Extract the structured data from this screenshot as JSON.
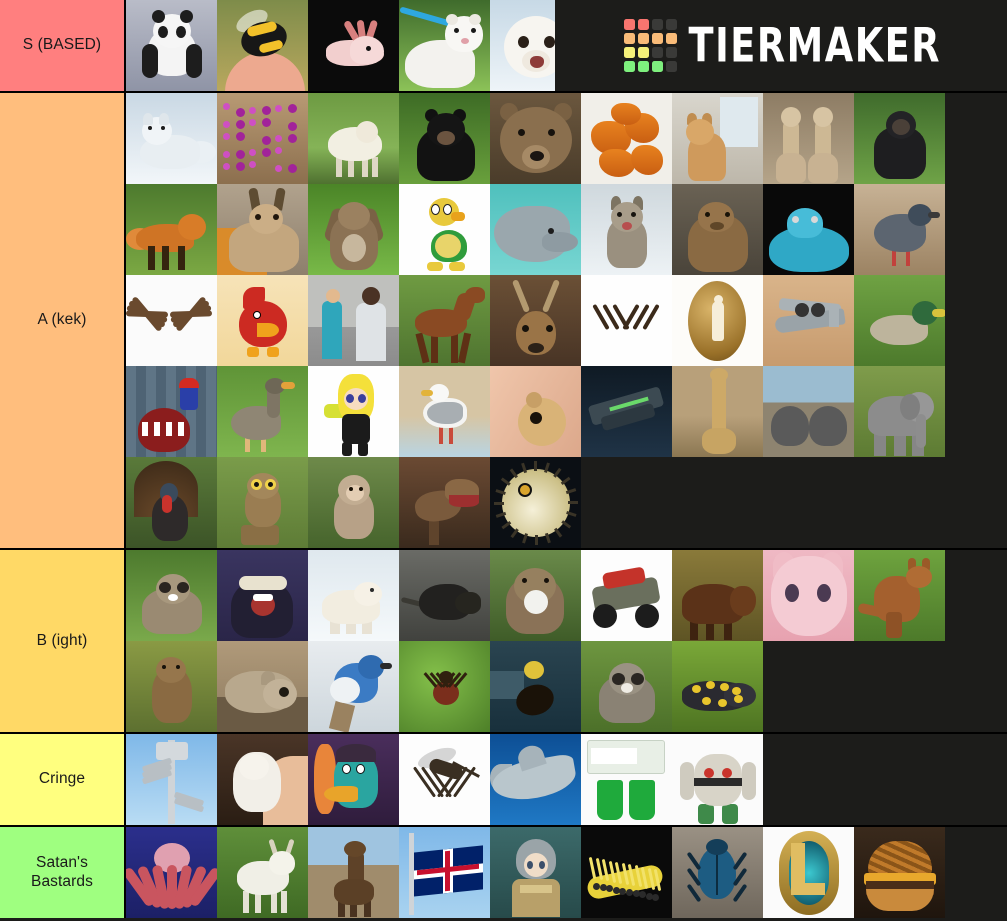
{
  "brand": {
    "name": "TIERMAKER",
    "logo_grid_colors": [
      [
        "#f9756f",
        "#f9756f",
        "#3a3a38",
        "#3a3a38"
      ],
      [
        "#f9bb78",
        "#f9bb78",
        "#f9bb78",
        "#f9bb78"
      ],
      [
        "#f5f07a",
        "#f5f07a",
        "#3a3a38",
        "#3a3a38"
      ],
      [
        "#7ef07e",
        "#7ef07e",
        "#7ef07e",
        "#3a3a38"
      ]
    ],
    "text_color": "#ffffff",
    "background": "#1c1c1a"
  },
  "tiers": [
    {
      "label": "S (BASED)",
      "color": "#ff7f7f",
      "items": [
        {
          "name": "panda",
          "art": "panda"
        },
        {
          "name": "bumblebee",
          "art": "bee"
        },
        {
          "name": "axolotl",
          "art": "axolotl"
        },
        {
          "name": "ferret",
          "art": "ferret"
        },
        {
          "name": "harp-seal-pup",
          "art": "seal"
        }
      ]
    },
    {
      "label": "A (kek)",
      "color": "#ffbe7d",
      "items": [
        {
          "name": "arctic-fox",
          "art": "arcticfox"
        },
        {
          "name": "sea-anemone",
          "art": "anemone"
        },
        {
          "name": "sheep",
          "art": "sheep"
        },
        {
          "name": "black-bear",
          "art": "blackbear"
        },
        {
          "name": "grizzly-bear",
          "art": "grizzly"
        },
        {
          "name": "fried-chicken",
          "art": "chicken"
        },
        {
          "name": "shiba-inu",
          "art": "shiba"
        },
        {
          "name": "alpacas",
          "art": "alpaca"
        },
        {
          "name": "gorilla",
          "art": "gorilla"
        },
        {
          "name": "red-fox",
          "art": "redfox"
        },
        {
          "name": "caracal",
          "art": "caracal"
        },
        {
          "name": "lop-rabbit",
          "art": "rabbit"
        },
        {
          "name": "koopa-troopa",
          "art": "koopa"
        },
        {
          "name": "dolphin",
          "art": "dolphin"
        },
        {
          "name": "wolf",
          "art": "wolf"
        },
        {
          "name": "capybara",
          "art": "capybara"
        },
        {
          "name": "blue-viper-snake",
          "art": "viper"
        },
        {
          "name": "pigeon",
          "art": "pigeon"
        },
        {
          "name": "tarantula",
          "art": "tarantula"
        },
        {
          "name": "cardinal-bird-cartoon",
          "art": "cardinal"
        },
        {
          "name": "humans",
          "art": "people"
        },
        {
          "name": "horse",
          "art": "horse"
        },
        {
          "name": "whitetail-deer",
          "art": "deer"
        },
        {
          "name": "ant",
          "art": "ant"
        },
        {
          "name": "human-in-amber",
          "art": "amber"
        },
        {
          "name": "a10-warthog-jet",
          "art": "a10"
        },
        {
          "name": "mallard-duck",
          "art": "mallard"
        },
        {
          "name": "chain-chomp",
          "art": "chomp"
        },
        {
          "name": "goose",
          "art": "goose"
        },
        {
          "name": "splatoon-inkling",
          "art": "inkling"
        },
        {
          "name": "seagull",
          "art": "seagull"
        },
        {
          "name": "hamster",
          "art": "hamster"
        },
        {
          "name": "gjallarhorn",
          "art": "gjallarhorn"
        },
        {
          "name": "giraffe",
          "art": "giraffe"
        },
        {
          "name": "elephant-seals",
          "art": "elephantseal"
        },
        {
          "name": "elephant",
          "art": "elephant"
        },
        {
          "name": "wild-turkey",
          "art": "turkey"
        },
        {
          "name": "burrowing-owl",
          "art": "owl"
        },
        {
          "name": "baby-macaque",
          "art": "monkey"
        },
        {
          "name": "raptor-dinosaur",
          "art": "raptor"
        },
        {
          "name": "pufferfish",
          "art": "puffer"
        }
      ]
    },
    {
      "label": "B (ight)",
      "color": "#ffd966",
      "items": [
        {
          "name": "raccoon-dog",
          "art": "tanuki"
        },
        {
          "name": "honey-badger",
          "art": "badger"
        },
        {
          "name": "polar-bear",
          "art": "polarbear"
        },
        {
          "name": "rat",
          "art": "rat"
        },
        {
          "name": "otter",
          "art": "otter"
        },
        {
          "name": "halo-warthog",
          "art": "warthog"
        },
        {
          "name": "moose",
          "art": "moose"
        },
        {
          "name": "pink-cat-meme",
          "art": "pinkcat"
        },
        {
          "name": "kangaroo",
          "art": "kangaroo"
        },
        {
          "name": "marmot",
          "art": "marmot"
        },
        {
          "name": "cat",
          "art": "cat"
        },
        {
          "name": "blue-jay",
          "art": "bluejay"
        },
        {
          "name": "tick",
          "art": "tick"
        },
        {
          "name": "cockroach",
          "art": "roach"
        },
        {
          "name": "raccoon",
          "art": "raccoon"
        },
        {
          "name": "fire-salamander",
          "art": "salamander"
        }
      ]
    },
    {
      "label": "Cringe",
      "color": "#ffff7f",
      "items": [
        {
          "name": "cell-tower",
          "art": "tower"
        },
        {
          "name": "white-rat",
          "art": "whiterat"
        },
        {
          "name": "perry-the-platypus",
          "art": "perry"
        },
        {
          "name": "mosquito",
          "art": "mosquito"
        },
        {
          "name": "great-white-shark",
          "art": "shark"
        },
        {
          "name": "jello-cups",
          "art": "jello"
        },
        {
          "name": "registeel-pokemon",
          "art": "registeel"
        }
      ]
    },
    {
      "label": "Satan's Bastards",
      "color": "#9fff80",
      "items": [
        {
          "name": "octopus",
          "art": "octopus"
        },
        {
          "name": "goat",
          "art": "goat"
        },
        {
          "name": "llama",
          "art": "llama"
        },
        {
          "name": "uk-flag",
          "art": "ukflag"
        },
        {
          "name": "anime-character",
          "art": "anime"
        },
        {
          "name": "caterpillar",
          "art": "caterpillar"
        },
        {
          "name": "blue-beetle",
          "art": "beetle"
        },
        {
          "name": "league-of-legends-logo",
          "art": "lol"
        },
        {
          "name": "burger",
          "art": "burger"
        }
      ]
    }
  ]
}
